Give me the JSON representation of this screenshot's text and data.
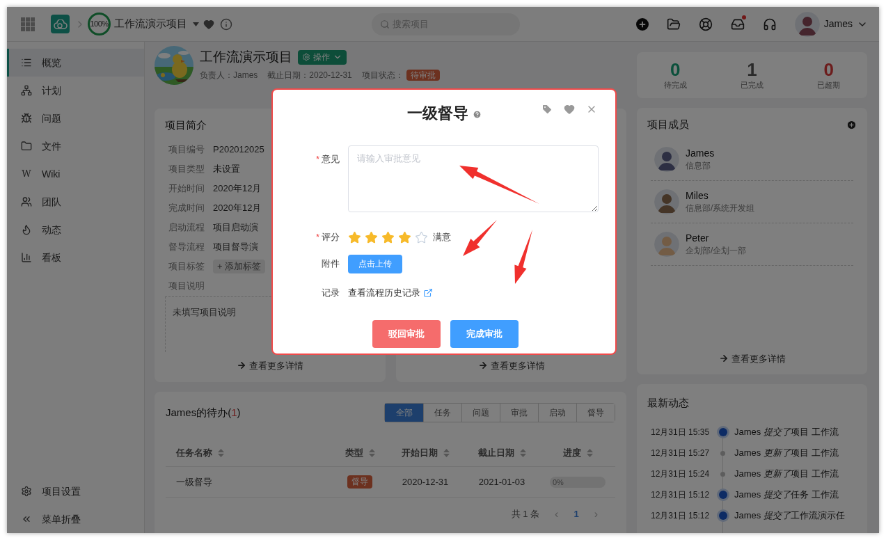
{
  "topbar": {
    "progress_text": "100%",
    "project_title": "工作流演示项目",
    "search": {
      "placeholder": "搜索项目"
    },
    "inbox_unread": true,
    "user_name": "James"
  },
  "sidebar": {
    "items": [
      {
        "label": "概览",
        "selected": true
      },
      {
        "label": "计划",
        "selected": false
      },
      {
        "label": "问题",
        "selected": false
      },
      {
        "label": "文件",
        "selected": false
      },
      {
        "label": "Wiki",
        "icon_text": "W",
        "selected": false
      },
      {
        "label": "团队",
        "selected": false
      },
      {
        "label": "动态",
        "selected": false
      },
      {
        "label": "看板",
        "selected": false
      }
    ],
    "footer": [
      {
        "label": "项目设置"
      },
      {
        "label": "菜单折叠"
      }
    ]
  },
  "project": {
    "title": "工作流演示项目",
    "action_button": "操作",
    "owner": "负责人：James",
    "deadline": "截止日期：2020-12-31",
    "status_label": "项目状态：",
    "status": "待审批"
  },
  "stats": [
    {
      "value": "0",
      "label": "待完成",
      "kind": "pending"
    },
    {
      "value": "1",
      "label": "已完成",
      "kind": "done"
    },
    {
      "value": "0",
      "label": "已超期",
      "kind": "overdue"
    }
  ],
  "summary": {
    "title": "项目简介",
    "rows": [
      {
        "label": "项目编号",
        "value": "P202012025"
      },
      {
        "label": "项目类型",
        "value": "未设置"
      },
      {
        "label": "开始时间",
        "value": "2020年12月"
      },
      {
        "label": "完成时间",
        "value": "2020年12月"
      },
      {
        "label": "启动流程",
        "value": "项目启动演"
      },
      {
        "label": "督导流程",
        "value": "项目督导演"
      },
      {
        "label": "项目标签",
        "kind": "tag_button",
        "value": "+ 添加标签"
      },
      {
        "label": "项目说明",
        "kind": "heading"
      }
    ],
    "description": "未填写项目说明",
    "more_link": "查看更多详情"
  },
  "second_card": {
    "more_link": "查看更多详情"
  },
  "members": {
    "title": "项目成员",
    "items": [
      {
        "name": "James",
        "dept": "信息部"
      },
      {
        "name": "Miles",
        "dept": "信息部/系统开发组"
      },
      {
        "name": "Peter",
        "dept": "企划部/企划一部"
      }
    ],
    "more_link": "查看更多详情"
  },
  "todo": {
    "title": "James的待办",
    "count_open": "(",
    "count": "1",
    "count_close": ")",
    "tabs": [
      {
        "label": "全部",
        "selected": true
      },
      {
        "label": "任务",
        "selected": false
      },
      {
        "label": "问题",
        "selected": false
      },
      {
        "label": "审批",
        "selected": false
      },
      {
        "label": "启动",
        "selected": false
      },
      {
        "label": "督导",
        "selected": false
      }
    ],
    "columns": [
      "任务名称",
      "类型",
      "开始日期",
      "截止日期",
      "进度"
    ],
    "rows": [
      {
        "name": "一级督导",
        "type": "督导",
        "start": "2020-12-31",
        "end": "2021-01-03",
        "level": 0,
        "progress_text": "0%"
      }
    ],
    "pagination": {
      "total": "共 1 条",
      "prev": "‹",
      "page": "1",
      "next": "›"
    }
  },
  "activity": {
    "title": "最新动态",
    "items": [
      {
        "time": "12月31日 15:35",
        "kind": "major",
        "actor": "James",
        "verb": "提交了",
        "object": "项目 工作流"
      },
      {
        "time": "12月31日 15:27",
        "kind": "minor",
        "actor": "James",
        "verb": "更新了",
        "object": "项目 工作流"
      },
      {
        "time": "12月31日 15:24",
        "kind": "minor",
        "actor": "James",
        "verb": "更新了",
        "object": "项目 工作流"
      },
      {
        "time": "12月31日 15:12",
        "kind": "major",
        "actor": "James",
        "verb": "提交了",
        "object": "任务 工作流"
      },
      {
        "time": "12月31日 15:12",
        "kind": "major",
        "actor": "James",
        "verb": "提交了",
        "object": "工作流演示任"
      }
    ]
  },
  "dialog": {
    "title": "一级督导",
    "fields": [
      {
        "kind": "textarea",
        "label": "意见",
        "required_mark": "*",
        "placeholder": "请输入审批意见"
      },
      {
        "kind": "rating",
        "label": "评分",
        "required_mark": "*",
        "stars": 4,
        "rating_text": "满意"
      },
      {
        "kind": "upload",
        "label": "附件",
        "button": "点击上传"
      },
      {
        "kind": "link",
        "label": "记录",
        "link": "查看流程历史记录"
      }
    ],
    "buttons": [
      {
        "label": "驳回审批",
        "kind": "danger"
      },
      {
        "label": "完成审批",
        "kind": "primary"
      }
    ]
  }
}
